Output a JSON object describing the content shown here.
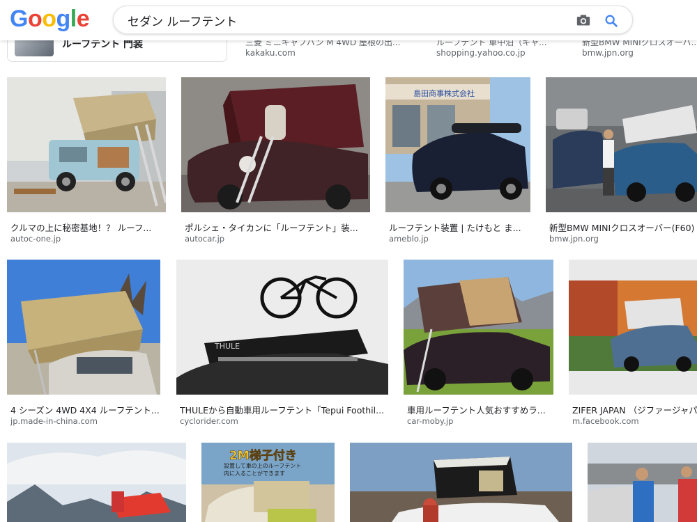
{
  "header": {
    "logo_letters": [
      "G",
      "o",
      "o",
      "g",
      "l",
      "e"
    ],
    "logo_colors": [
      "#4285F4",
      "#EA4335",
      "#FBBC05",
      "#4285F4",
      "#34A853",
      "#EA4335"
    ],
    "search_value": "セダン ルーフテント",
    "camera_icon": "camera-icon",
    "search_icon": "search-icon"
  },
  "top_partial": {
    "card_title": "ルーフテント 門装",
    "items": [
      {
        "text": "三菱 ミニキャブバン M 4WD 屋根の出...",
        "source": "kakaku.com"
      },
      {
        "text": "ルーフテント 車中泊（キャ...",
        "source": "shopping.yahoo.co.jp"
      },
      {
        "text": "新型BMW MINIクロスオーバ...",
        "source": "bmw.jpn.org"
      }
    ]
  },
  "results": [
    {
      "title": "クルマの上に秘密基地！？ ルーフ...",
      "source": "autoc-one.jp"
    },
    {
      "title": "ポルシェ・タイカンに「ルーフテント」装...",
      "source": "autocar.jp"
    },
    {
      "title": "ルーフテント装置 | たけもと ま...",
      "source": "ameblo.jp"
    },
    {
      "title": "新型BMW MINIクロスオーバー(F60)",
      "source": "bmw.jpn.org"
    },
    {
      "title": "4 シーズン 4WD 4X4 ルーフテント...",
      "source": "jp.made-in-china.com"
    },
    {
      "title": "THULEから自動車用ルーフテント「Tepui Foothil...",
      "source": "cyclorider.com"
    },
    {
      "title": "車用ルーフテント人気おすすめラ...",
      "source": "car-moby.jp"
    },
    {
      "title": "ZIFER JAPAN （ジファージャパ",
      "source": "m.facebook.com"
    },
    {
      "title": "",
      "source": ""
    },
    {
      "title": "",
      "source": ""
    },
    {
      "title": "",
      "source": ""
    },
    {
      "title": "",
      "source": ""
    }
  ],
  "image_texts": {
    "shop_sign": "島田商事株式会社",
    "ladder_banner": "2M梯子付き",
    "banner_sub1": "設置して車の上のルーフテント",
    "banner_sub2": "内に入ることができます",
    "thule_brand": "THULE"
  },
  "colors": {
    "title_text": "#202124",
    "source_text": "#5f6368",
    "search_blue": "#4285F4"
  }
}
